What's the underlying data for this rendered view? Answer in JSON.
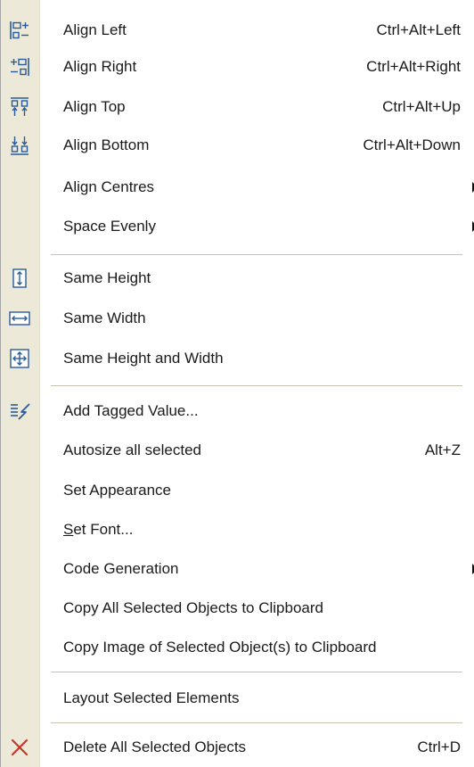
{
  "menu": {
    "items": [
      {
        "name": "align-left",
        "label": "Align Left",
        "shortcut": "Ctrl+Alt+Left",
        "icon": "align-left-icon"
      },
      {
        "name": "align-right",
        "label": "Align Right",
        "shortcut": "Ctrl+Alt+Right",
        "icon": "align-right-icon"
      },
      {
        "name": "align-top",
        "label": "Align Top",
        "shortcut": "Ctrl+Alt+Up",
        "icon": "align-top-icon"
      },
      {
        "name": "align-bottom",
        "label": "Align Bottom",
        "shortcut": "Ctrl+Alt+Down",
        "icon": "align-bottom-icon"
      },
      {
        "name": "align-centres",
        "label": "Align Centres",
        "shortcut": "",
        "submenu": true
      },
      {
        "name": "space-evenly",
        "label": "Space Evenly",
        "shortcut": "",
        "submenu": true
      },
      {
        "name": "same-height",
        "label": "Same Height",
        "shortcut": "",
        "icon": "same-height-icon"
      },
      {
        "name": "same-width",
        "label": "Same Width",
        "shortcut": "",
        "icon": "same-width-icon"
      },
      {
        "name": "same-height-and-width",
        "label": "Same Height and Width",
        "shortcut": "",
        "icon": "same-size-icon"
      },
      {
        "name": "add-tagged-value",
        "label": "Add Tagged Value...",
        "shortcut": "",
        "icon": "tagged-value-icon"
      },
      {
        "name": "autosize-all-selected",
        "label": "Autosize all selected",
        "shortcut": "Alt+Z"
      },
      {
        "name": "set-appearance",
        "label": "Set Appearance",
        "shortcut": ""
      },
      {
        "name": "set-font",
        "label": "Set Font...",
        "shortcut": "",
        "mnemonic": "S"
      },
      {
        "name": "code-generation",
        "label": "Code Generation",
        "shortcut": "",
        "submenu": true
      },
      {
        "name": "copy-all-selected-objects",
        "label": "Copy All Selected Objects to Clipboard",
        "shortcut": ""
      },
      {
        "name": "copy-image-of-selected-objects",
        "label": "Copy Image of Selected Object(s) to Clipboard",
        "shortcut": ""
      },
      {
        "name": "layout-selected-elements",
        "label": "Layout Selected Elements",
        "shortcut": ""
      },
      {
        "name": "delete-all-selected-objects",
        "label": "Delete All Selected Objects",
        "shortcut": "Ctrl+D",
        "icon": "delete-icon"
      }
    ]
  },
  "colors": {
    "gutter": "#ece9d8",
    "icon_blue": "#2a5a9e",
    "delete_red": "#c0392b",
    "separator": "#c5c2b2"
  }
}
